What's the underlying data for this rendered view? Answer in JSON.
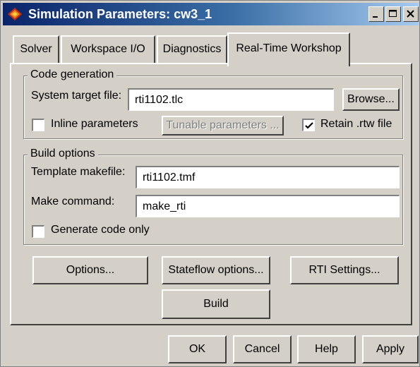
{
  "window": {
    "title": "Simulation Parameters: cw3_1",
    "icon": "matlab-simulink-icon"
  },
  "tabs": [
    {
      "label": "Solver",
      "active": false
    },
    {
      "label": "Workspace I/O",
      "active": false
    },
    {
      "label": "Diagnostics",
      "active": false
    },
    {
      "label": "Real-Time Workshop",
      "active": true
    }
  ],
  "code_generation": {
    "legend": "Code generation",
    "system_target_label": "System target file:",
    "system_target_value": "rti1102.tlc",
    "browse_label": "Browse...",
    "inline_params_label": "Inline parameters",
    "inline_params_checked": false,
    "tunable_params_label": "Tunable parameters ...",
    "retain_rtw_label": "Retain .rtw file",
    "retain_rtw_checked": true
  },
  "build_options": {
    "legend": "Build options",
    "template_makefile_label": "Template makefile:",
    "template_makefile_value": "rti1102.tmf",
    "make_command_label": "Make command:",
    "make_command_value": "make_rti",
    "generate_code_only_label": "Generate code only",
    "generate_code_only_checked": false
  },
  "actions": {
    "options_label": "Options...",
    "stateflow_label": "Stateflow options...",
    "rti_settings_label": "RTI Settings...",
    "build_label": "Build"
  },
  "footer": {
    "ok_label": "OK",
    "cancel_label": "Cancel",
    "help_label": "Help",
    "apply_label": "Apply"
  }
}
